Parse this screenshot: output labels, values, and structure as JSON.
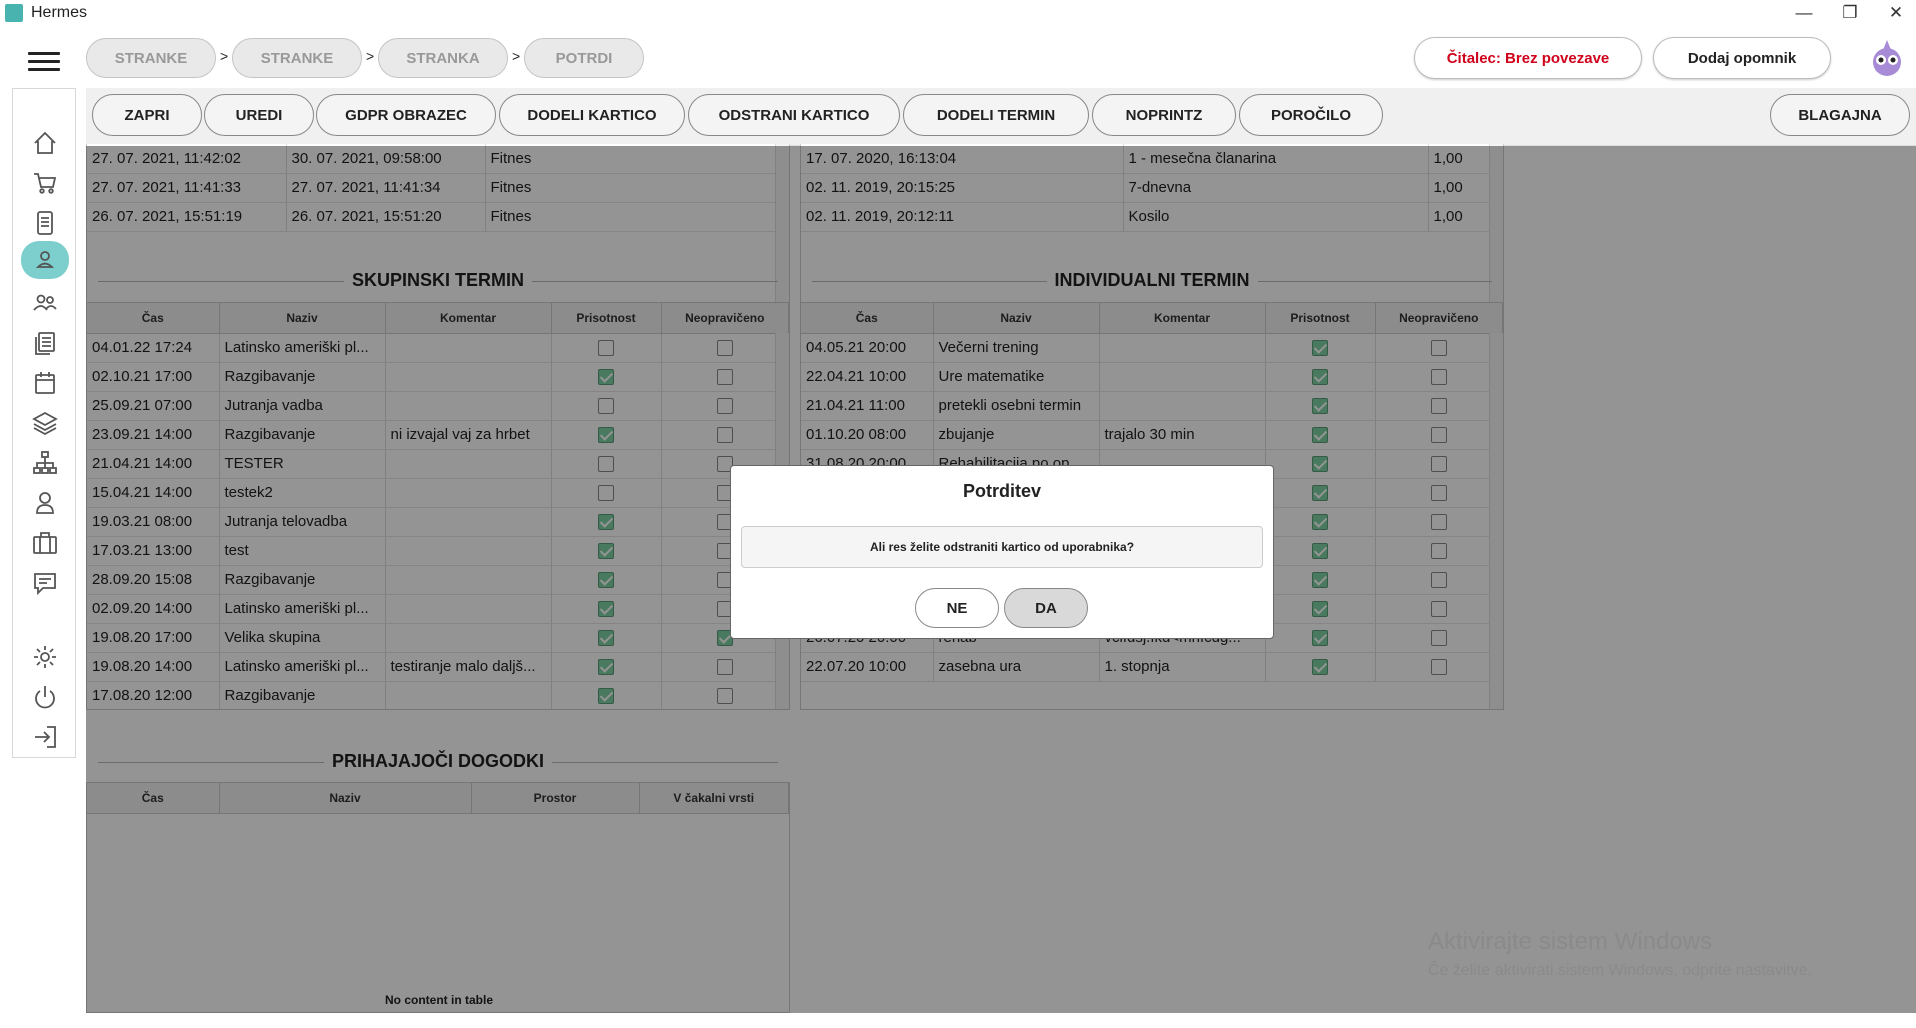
{
  "window": {
    "title": "Hermes",
    "minimize": "—",
    "maximize": "❐",
    "close": "✕"
  },
  "breadcrumb": [
    "STRANKE",
    "STRANKE",
    "STRANKA",
    "POTRDI"
  ],
  "breadcrumb_sep": ">",
  "header": {
    "reader_label": "Čitalec: Brez povezave",
    "add_reminder": "Dodaj opomnik"
  },
  "toolbar": {
    "buttons": [
      "ZAPRI",
      "UREDI",
      "GDPR OBRAZEC",
      "DODELI KARTICO",
      "ODSTRANI KARTICO",
      "DODELI TERMIN",
      "NOPRINTZ",
      "POROČILO"
    ],
    "right": "BLAGAJNA"
  },
  "top_left_rows": [
    [
      "27. 07. 2021, 11:42:02",
      "30. 07. 2021, 09:58:00",
      "Fitnes"
    ],
    [
      "27. 07. 2021, 11:41:33",
      "27. 07. 2021, 11:41:34",
      "Fitnes"
    ],
    [
      "26. 07. 2021, 15:51:19",
      "26. 07. 2021, 15:51:20",
      "Fitnes"
    ]
  ],
  "top_right_rows": [
    [
      "17. 07. 2020, 16:13:04",
      "1 - mesečna članarina",
      "1,00"
    ],
    [
      "02. 11. 2019, 20:15:25",
      "7-dnevna",
      "1,00"
    ],
    [
      "02. 11. 2019, 20:12:11",
      "Kosilo",
      "1,00"
    ]
  ],
  "group": {
    "title": "SKUPINSKI TERMIN",
    "headers": [
      "Čas",
      "Naziv",
      "Komentar",
      "Prisotnost",
      "Neopravičeno"
    ],
    "rows": [
      [
        "04.01.22 17:24",
        "Latinsko ameriški pl...",
        "",
        false,
        false
      ],
      [
        "02.10.21 17:00",
        "Razgibavanje",
        "",
        true,
        false
      ],
      [
        "25.09.21 07:00",
        "Jutranja vadba",
        "",
        false,
        false
      ],
      [
        "23.09.21 14:00",
        "Razgibavanje",
        "ni izvajal vaj za hrbet",
        true,
        false
      ],
      [
        "21.04.21 14:00",
        "TESTER",
        "",
        false,
        false
      ],
      [
        "15.04.21 14:00",
        "testek2",
        "",
        false,
        false
      ],
      [
        "19.03.21 08:00",
        "Jutranja telovadba",
        "",
        true,
        false
      ],
      [
        "17.03.21 13:00",
        "test",
        "",
        true,
        false
      ],
      [
        "28.09.20 15:08",
        "Razgibavanje",
        "",
        true,
        false
      ],
      [
        "02.09.20 14:00",
        "Latinsko ameriški pl...",
        "",
        true,
        false
      ],
      [
        "19.08.20 17:00",
        "Velika skupina",
        "",
        true,
        true
      ],
      [
        "19.08.20 14:00",
        "Latinsko ameriški pl...",
        "testiranje malo daljš...",
        true,
        false
      ],
      [
        "17.08.20 12:00",
        "Razgibavanje",
        "",
        true,
        false
      ]
    ]
  },
  "individual": {
    "title": "INDIVIDUALNI TERMIN",
    "headers": [
      "Čas",
      "Naziv",
      "Komentar",
      "Prisotnost",
      "Neopravičeno"
    ],
    "rows": [
      [
        "04.05.21 20:00",
        "Večerni trening",
        "",
        true,
        false
      ],
      [
        "22.04.21 10:00",
        "Ure matematike",
        "",
        true,
        false
      ],
      [
        "21.04.21 11:00",
        "pretekli osebni termin",
        "",
        true,
        false
      ],
      [
        "01.10.20 08:00",
        "zbujanje",
        "trajalo 30 min",
        true,
        false
      ],
      [
        "31.08.20 20:00",
        "Rehabilitacija po op...",
        "",
        true,
        false
      ],
      [
        "",
        "",
        "",
        true,
        false
      ],
      [
        "",
        "",
        "",
        true,
        false
      ],
      [
        "",
        "",
        "",
        true,
        false
      ],
      [
        "",
        "",
        "",
        true,
        false
      ],
      [
        "",
        "",
        "",
        true,
        false
      ],
      [
        "26.07.20 20:00",
        "rehab",
        "vclfdsj.fkd<mnfčdg...",
        true,
        false
      ],
      [
        "22.07.20 10:00",
        "zasebna ura",
        "1. stopnja",
        true,
        false
      ]
    ]
  },
  "events": {
    "title": "PRIHAJAJOČI DOGODKI",
    "headers": [
      "Čas",
      "Naziv",
      "Prostor",
      "V čakalni vrsti"
    ],
    "empty": "No content in table"
  },
  "dialog": {
    "title": "Potrditev",
    "message": "Ali res želite odstraniti kartico od uporabnika?",
    "no": "NE",
    "yes": "DA"
  },
  "watermark": {
    "line1": "Aktivirajte sistem Windows",
    "line2": "Če želite aktivirati sistem Windows, odprite nastavitve."
  },
  "sidebar_icons": [
    "home-icon",
    "cart-icon",
    "document-icon",
    "user-icon",
    "users-icon",
    "list-icon",
    "calendar-icon",
    "layers-icon",
    "network-icon",
    "hand-icon",
    "briefcase-icon",
    "chat-icon",
    "gear-icon",
    "power-icon",
    "logout-icon"
  ]
}
